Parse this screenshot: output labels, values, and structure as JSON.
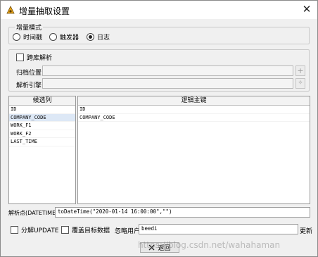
{
  "window": {
    "title": "增量抽取设置",
    "close_glyph": "✕"
  },
  "mode_group": {
    "legend": "增量模式",
    "options": [
      {
        "label": "时间戳",
        "selected": false
      },
      {
        "label": "触发器",
        "selected": false
      },
      {
        "label": "日志",
        "selected": true
      }
    ]
  },
  "cross_db": {
    "label": "跨库解析",
    "checked": false,
    "archive_label": "归档位置:",
    "archive_value": "",
    "archive_button": "+",
    "engine_label": "解析引擎:",
    "engine_value": "",
    "engine_button": "✧"
  },
  "candidate_columns": {
    "header": "候选列",
    "items": [
      "ID",
      "COMPANY_CODE",
      "WORK_F1",
      "WORK_F2",
      "LAST_TIME"
    ],
    "selected_index": 1
  },
  "logical_keys": {
    "header": "逻辑主键",
    "items": [
      "ID",
      "COMPANY_CODE"
    ]
  },
  "parse_point": {
    "label": "解析点(DATETIME):",
    "value": "toDateTime(\"2020-01-14 16:00:00\",\"\")"
  },
  "options_row": {
    "split_update": {
      "label": "分解UPDATE",
      "checked": false
    },
    "overwrite_target": {
      "label": "覆盖目标数据",
      "checked": false
    },
    "ignore_user_label": "忽略用户",
    "ignore_user_value": "beedi",
    "update_label": "更新"
  },
  "footer": {
    "return_label": "返回",
    "return_icon": "close-icon"
  },
  "watermark": "https://blog.csdn.net/wahahaman"
}
